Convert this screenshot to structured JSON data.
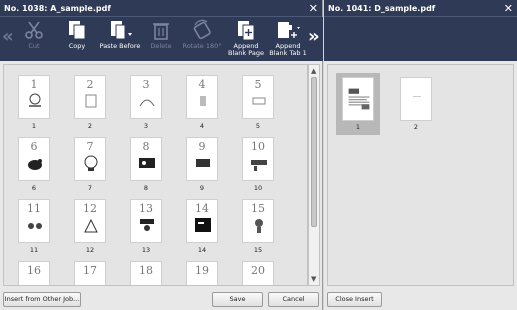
{
  "left": {
    "title": "No. 1038: A_sample.pdf",
    "toolbar": {
      "cut": "Cut",
      "copy": "Copy",
      "paste_before": "Paste Before",
      "delete": "Delete",
      "rotate": "Rotate 180°",
      "append_blank_page": "Append Blank Page",
      "append_blank_tab": "Append Blank Tab 1"
    },
    "pages": [
      "1",
      "2",
      "3",
      "4",
      "5",
      "6",
      "7",
      "8",
      "9",
      "10",
      "11",
      "12",
      "13",
      "14",
      "15",
      "16",
      "17",
      "18",
      "19",
      "20"
    ],
    "buttons": {
      "insert_other": "Insert from Other Job...",
      "save": "Save",
      "cancel": "Cancel"
    }
  },
  "right": {
    "title": "No. 1041: D_sample.pdf",
    "pages": [
      "1",
      "2"
    ],
    "buttons": {
      "close_insert": "Close Insert"
    }
  }
}
